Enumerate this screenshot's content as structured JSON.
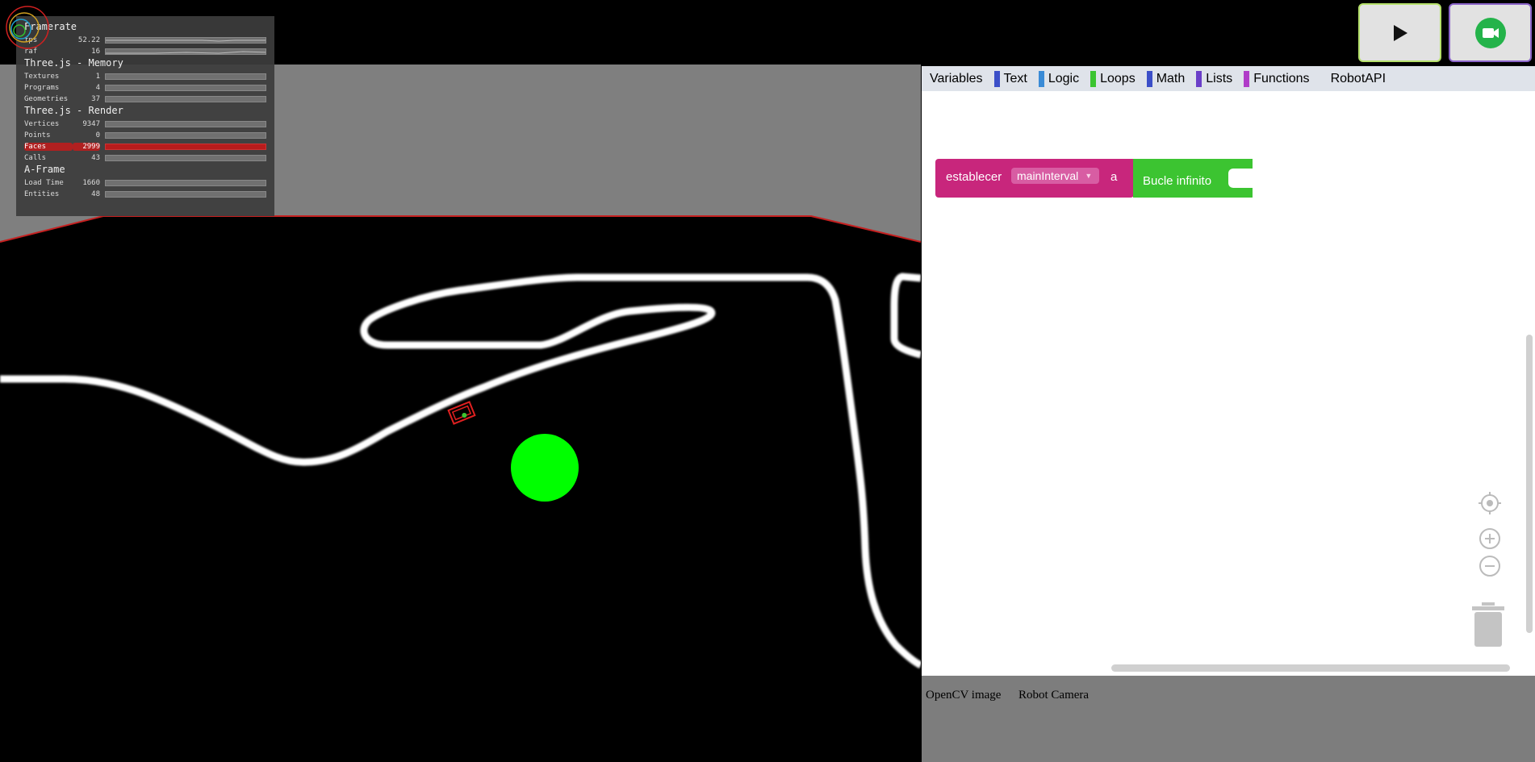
{
  "stats": {
    "groups": [
      {
        "title": "Framerate",
        "rows": [
          {
            "label": "fps",
            "value": "52.22"
          },
          {
            "label": "raf",
            "value": "16"
          }
        ]
      },
      {
        "title": "Three.js - Memory",
        "rows": [
          {
            "label": "Textures",
            "value": "1"
          },
          {
            "label": "Programs",
            "value": "4"
          },
          {
            "label": "Geometries",
            "value": "37"
          }
        ]
      },
      {
        "title": "Three.js - Render",
        "rows": [
          {
            "label": "Vertices",
            "value": "9347"
          },
          {
            "label": "Points",
            "value": "0"
          },
          {
            "label": "Faces",
            "value": "2999"
          },
          {
            "label": "Calls",
            "value": "43"
          }
        ]
      },
      {
        "title": "A-Frame",
        "rows": [
          {
            "label": "Load Time",
            "value": "1660"
          },
          {
            "label": "Entities",
            "value": "48"
          }
        ]
      }
    ]
  },
  "top_buttons": {
    "play_icon": "play-icon",
    "camera_icon": "video-camera-icon"
  },
  "toolbox": {
    "categories": [
      {
        "label": "Variables",
        "color": ""
      },
      {
        "label": "Text",
        "color": "#3c4fc8"
      },
      {
        "label": "Logic",
        "color": "#3a8bd6"
      },
      {
        "label": "Loops",
        "color": "#3cc431"
      },
      {
        "label": "Math",
        "color": "#3c4fc8"
      },
      {
        "label": "Lists",
        "color": "#6b3fc8"
      },
      {
        "label": "Functions",
        "color": "#b03cc8"
      },
      {
        "label": "RobotAPI",
        "color": ""
      }
    ]
  },
  "blocks": {
    "set_label": "establecer",
    "set_variable": "mainInterval",
    "set_to": "a",
    "loop_label": "Bucle infinito",
    "set_color": "#c8267c",
    "loop_color": "#3cc431"
  },
  "bottom_tabs": {
    "opencv": "OpenCV image",
    "camera": "Robot Camera"
  },
  "scene": {
    "floor_color": "#000000",
    "wall_color": "#7f7f7f",
    "target_color": "#00ff00"
  }
}
